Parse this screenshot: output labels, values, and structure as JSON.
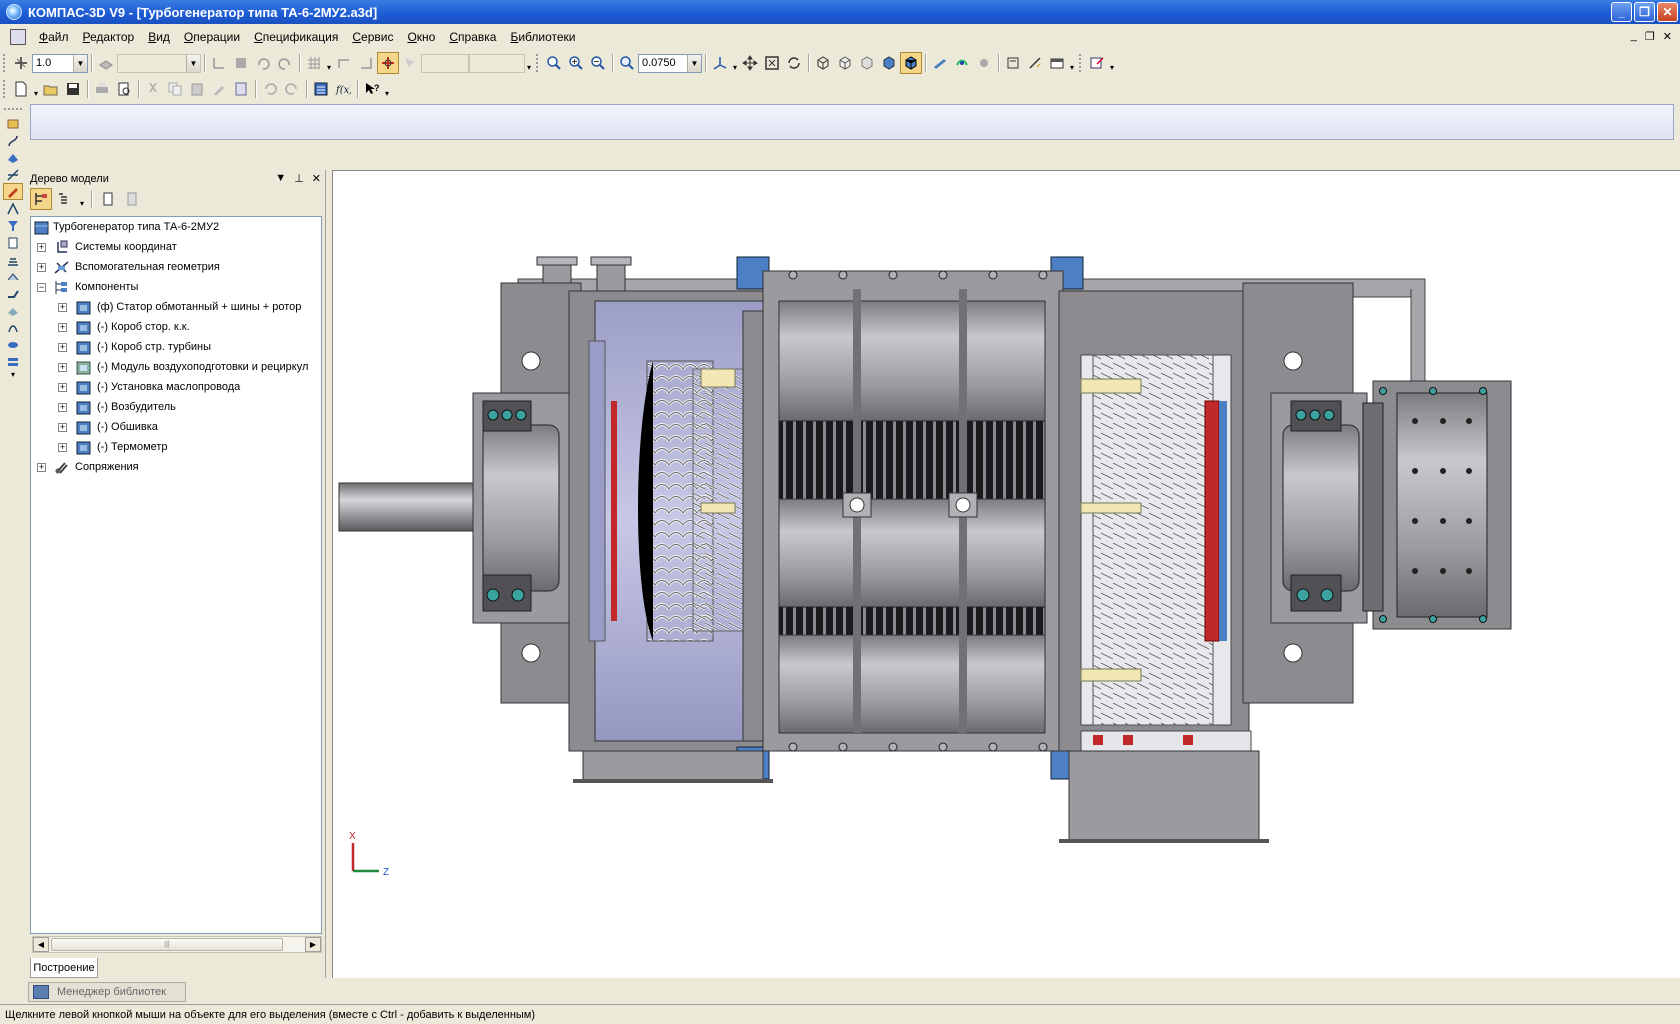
{
  "window": {
    "title": "КОМПАС-3D V9 - [Турбогенератор типа ТА-6-2МУ2.a3d]",
    "minimize": "_",
    "maximize": "❐",
    "close": "✕"
  },
  "menu": {
    "items": [
      "Файл",
      "Редактор",
      "Вид",
      "Операции",
      "Спецификация",
      "Сервис",
      "Окно",
      "Справка",
      "Библиотеки"
    ],
    "mdi_minimize": "_",
    "mdi_restore": "❐",
    "mdi_close": "✕"
  },
  "toolbar": {
    "step_value": "1.0",
    "zoom_value": "0.0750"
  },
  "tree": {
    "header": "Дерево модели",
    "pin": "⊥",
    "close": "✕",
    "items": [
      {
        "label": "Турбогенератор типа ТА-6-2МУ2"
      },
      {
        "label": "Системы координат"
      },
      {
        "label": "Вспомогательная геометрия"
      },
      {
        "label": "Компоненты"
      },
      {
        "label": "(ф) Статор обмотанный + шины + ротор"
      },
      {
        "label": "(-) Короб стор. к.к."
      },
      {
        "label": "(-) Короб стр. турбины"
      },
      {
        "label": "(-) Модуль воздухоподготовки и рециркул"
      },
      {
        "label": "(-) Установка маслопровода"
      },
      {
        "label": "(-) Возбудитель"
      },
      {
        "label": "(-) Обшивка"
      },
      {
        "label": "(-) Термометр"
      },
      {
        "label": "Сопряжения"
      }
    ],
    "tab_label": "Построение"
  },
  "library_tab": "Менеджер библиотек",
  "axes": {
    "x_label": "X",
    "z_label": "Z"
  },
  "status": "Щелкните левой кнопкой мыши на объекте для его выделения (вместе с Ctrl - добавить к выделенным)",
  "colors": {
    "titlebar": "#1c5bd4",
    "model_gray": "#8c8c90",
    "accent_blue": "#4d7fc4",
    "accent_red": "#c0282a",
    "active_tool": "#f6d68a"
  }
}
